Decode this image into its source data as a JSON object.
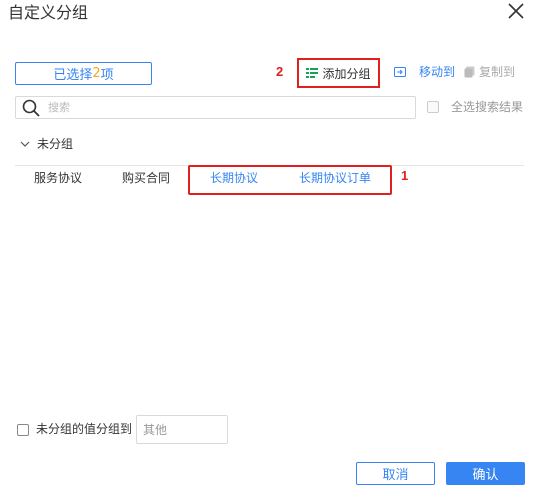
{
  "dialog": {
    "title": "自定义分组"
  },
  "toolbar": {
    "selected_prefix": "已选择",
    "selected_count": "2",
    "selected_suffix": "项",
    "add_group_label": "添加分组",
    "move_to_label": "移动到",
    "copy_to_label": "复制到"
  },
  "annotations": {
    "mark_1": "1",
    "mark_2": "2"
  },
  "search": {
    "placeholder": "搜索",
    "value": "",
    "select_all_label": "全选搜索结果",
    "select_all_checked": false
  },
  "group": {
    "name": "未分组",
    "items": [
      {
        "label": "服务协议",
        "selected": false
      },
      {
        "label": "购买合同",
        "selected": false
      },
      {
        "label": "长期协议",
        "selected": true
      },
      {
        "label": "长期协议订单",
        "selected": true
      }
    ]
  },
  "footer": {
    "ungroup_label": "未分组的值分组到",
    "ungroup_checked": false,
    "other_value": "其他",
    "cancel_label": "取消",
    "ok_label": "确认"
  },
  "colors": {
    "accent": "#3685f2",
    "highlight": "#e02020",
    "count": "#f5a623"
  }
}
